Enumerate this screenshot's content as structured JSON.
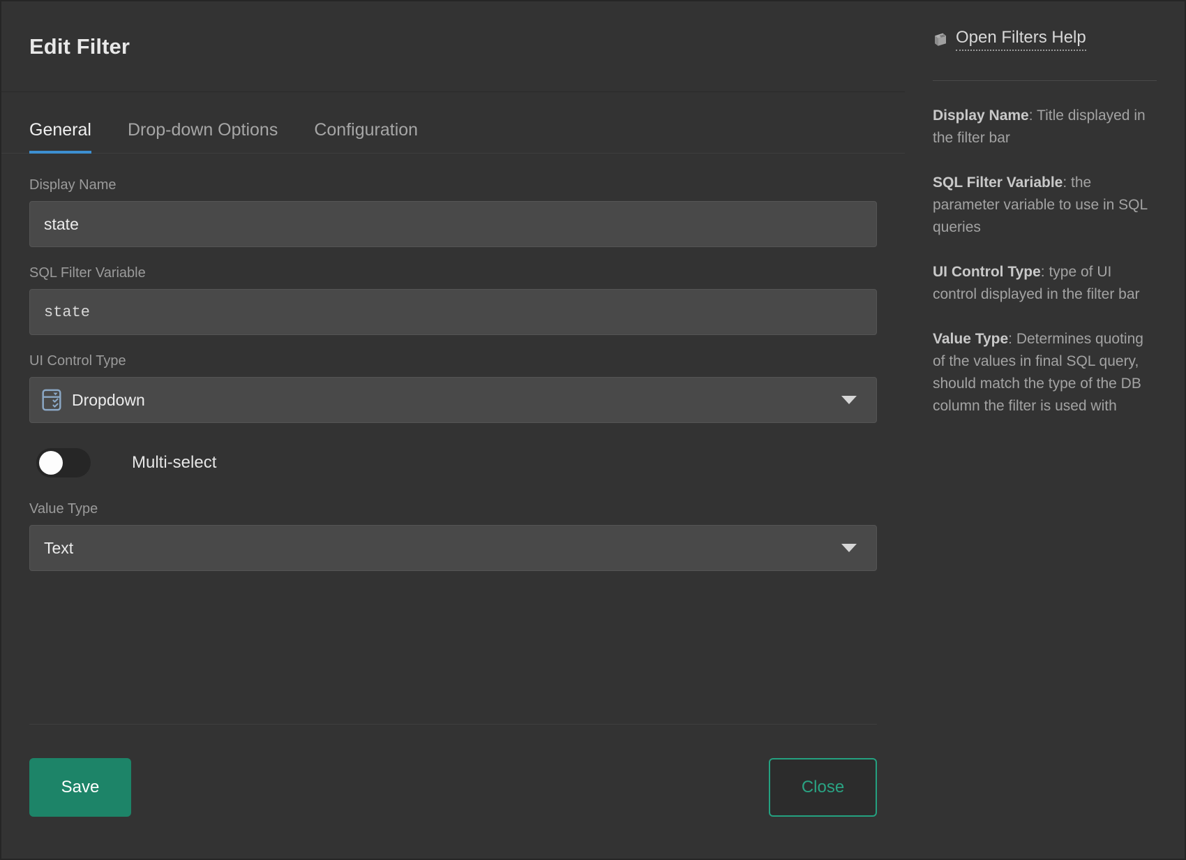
{
  "dialog": {
    "title": "Edit Filter"
  },
  "tabs": [
    {
      "label": "General",
      "active": true
    },
    {
      "label": "Drop-down Options",
      "active": false
    },
    {
      "label": "Configuration",
      "active": false
    }
  ],
  "form": {
    "display_name": {
      "label": "Display Name",
      "value": "state"
    },
    "sql_filter_variable": {
      "label": "SQL Filter Variable",
      "value": "state"
    },
    "ui_control_type": {
      "label": "UI Control Type",
      "value": "Dropdown",
      "icon": "dropdown-list-icon"
    },
    "multi_select": {
      "label": "Multi-select",
      "state": "off"
    },
    "value_type": {
      "label": "Value Type",
      "value": "Text"
    }
  },
  "footer": {
    "save_label": "Save",
    "close_label": "Close"
  },
  "help": {
    "link_label": "Open Filters Help",
    "link_icon": "book-icon",
    "items": [
      {
        "term": "Display Name",
        "desc": ": Title displayed in the filter bar"
      },
      {
        "term": "SQL Filter Variable",
        "desc": ": the parameter variable to use in SQL queries"
      },
      {
        "term": "UI Control Type",
        "desc": ": type of UI control displayed in the filter bar"
      },
      {
        "term": "Value Type",
        "desc": ": Determines quoting of the values in final SQL query, should match the type of the DB column the filter is used with"
      }
    ]
  },
  "colors": {
    "accent_tab": "#3d8fd1",
    "save_button": "#1d8468",
    "close_outline": "#24a180",
    "panel_bg": "#333333",
    "input_bg": "#494949",
    "icon_blue": "#8ba8c6"
  }
}
